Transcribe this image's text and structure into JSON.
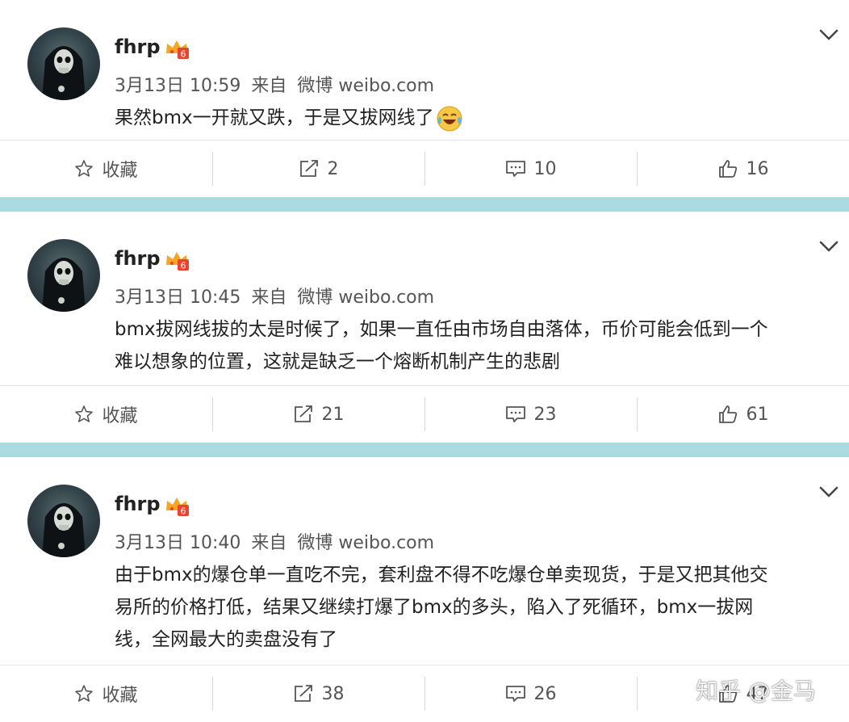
{
  "posts": [
    {
      "username": "fhrp",
      "date": "3月13日 10:59",
      "source_prefix": "来自",
      "source": "微博 weibo.com",
      "lines": [
        "果然bmx一开就又跌，于是又拔网线了"
      ],
      "emoji_icon": "laugh-cry-emoji",
      "actions": {
        "favorite": "收藏",
        "repost": "2",
        "comment": "10",
        "like": "16"
      }
    },
    {
      "username": "fhrp",
      "date": "3月13日 10:45",
      "source_prefix": "来自",
      "source": "微博 weibo.com",
      "lines": [
        "bmx拔网线拔的太是时候了，如果一直任由市场自由落体，币价可能会低到一个",
        "难以想象的位置，这就是缺乏一个熔断机制产生的悲剧"
      ],
      "actions": {
        "favorite": "收藏",
        "repost": "21",
        "comment": "23",
        "like": "61"
      }
    },
    {
      "username": "fhrp",
      "date": "3月13日 10:40",
      "source_prefix": "来自",
      "source": "微博 weibo.com",
      "lines": [
        "由于bmx的爆仓单一直吃不完，套利盘不得不吃爆仓单卖现货，于是又把其他交",
        "易所的价格打低，结果又继续打爆了bmx的多头，陷入了死循环，bmx一拔网",
        "线，全网最大的卖盘没有了"
      ],
      "actions": {
        "favorite": "收藏",
        "repost": "38",
        "comment": "26",
        "like": "47"
      }
    }
  ],
  "watermark": "知乎 @金马",
  "colors": {
    "separator": "#a9dbe0",
    "badge": "#f5a623",
    "badge_level": "#e8452c"
  }
}
